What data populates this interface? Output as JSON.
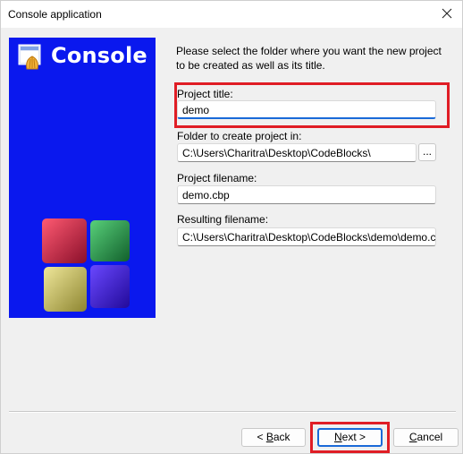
{
  "window": {
    "title": "Console application",
    "close_glyph": "✕"
  },
  "banner": {
    "title": "Console",
    "background": "#0a18ee"
  },
  "instructions": "Please select the folder where you want the new project to be created as well as its title.",
  "fields": {
    "project_title": {
      "label": "Project title:",
      "value": "demo"
    },
    "folder": {
      "label": "Folder to create project in:",
      "value": "C:\\Users\\Charitra\\Desktop\\CodeBlocks\\"
    },
    "project_filename": {
      "label": "Project filename:",
      "value": "demo.cbp"
    },
    "resulting_filename": {
      "label": "Resulting filename:",
      "value": "C:\\Users\\Charitra\\Desktop\\CodeBlocks\\demo\\demo.c"
    }
  },
  "browse_button": {
    "label": "..."
  },
  "buttons": {
    "back": {
      "prefix": "< ",
      "mnemonic": "B",
      "rest": "ack"
    },
    "next": {
      "mnemonic": "N",
      "rest": "ext >"
    },
    "cancel": {
      "mnemonic": "C",
      "rest": "ancel"
    }
  },
  "colors": {
    "highlight": "#e01d25",
    "focus": "#1a6ad8"
  }
}
